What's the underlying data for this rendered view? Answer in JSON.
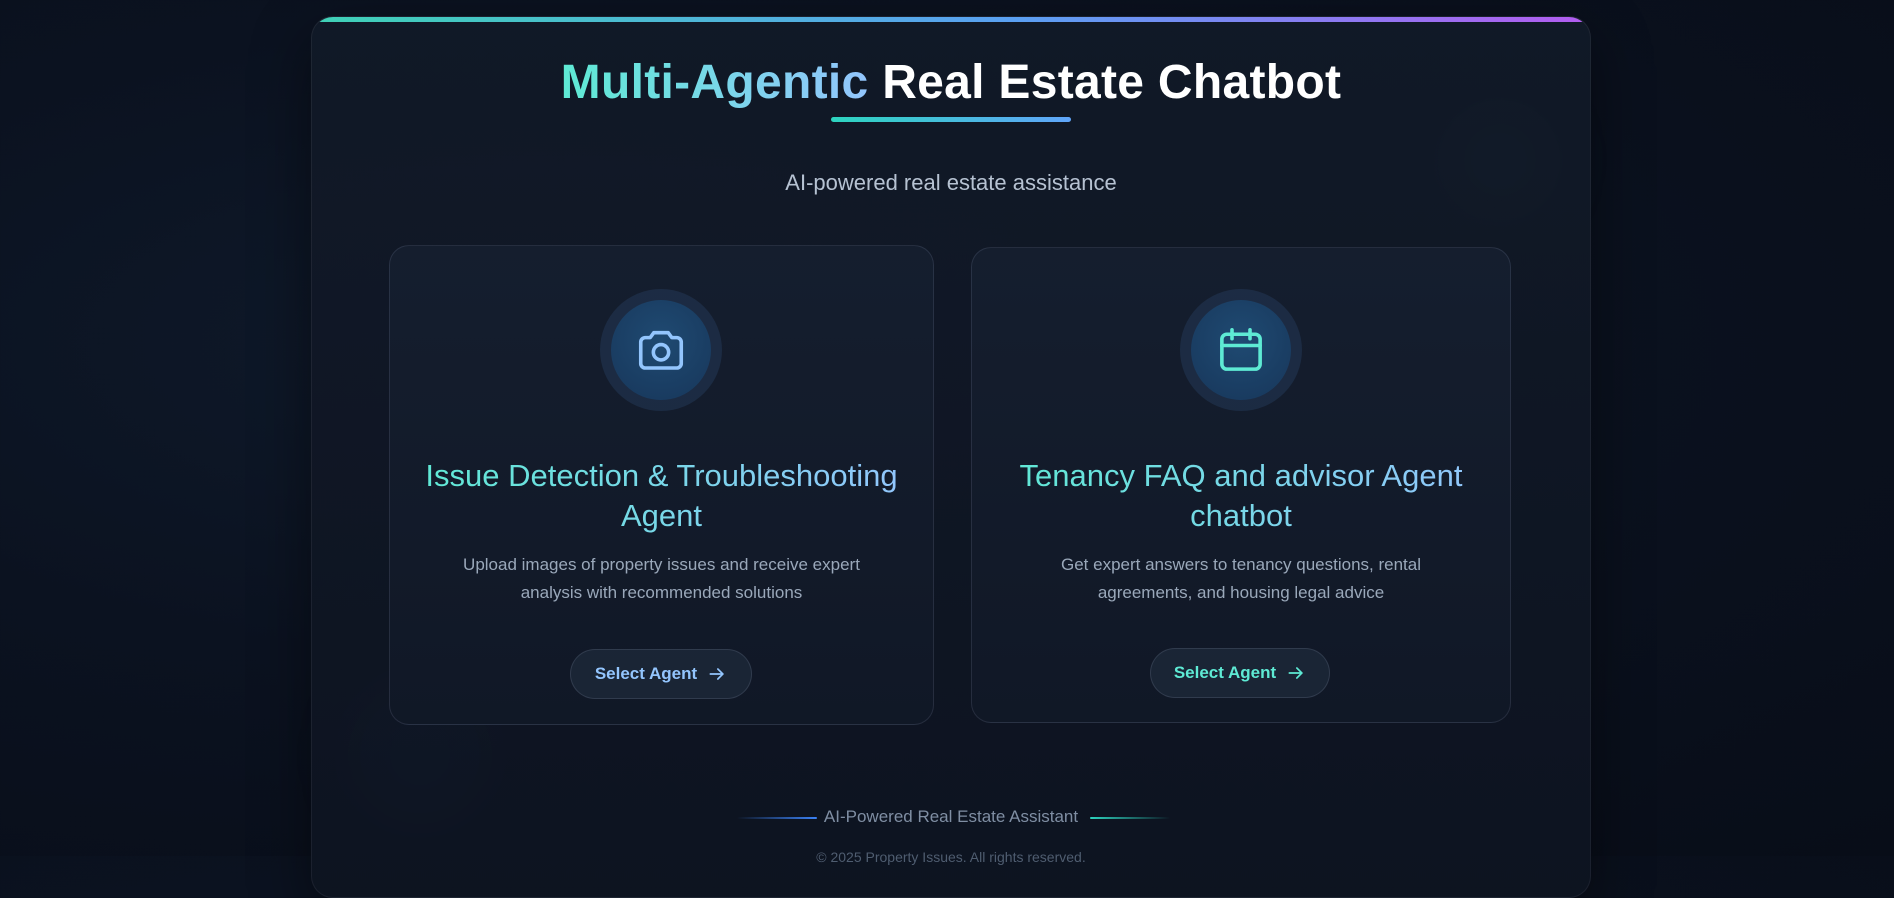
{
  "header": {
    "title_accent": "Multi-Agentic",
    "title_rest": "Real Estate Chatbot",
    "subtitle": "AI-powered real estate assistance"
  },
  "agents": [
    {
      "icon": "camera-icon",
      "title": "Issue Detection & Troubleshooting Agent",
      "description": "Upload images of property issues and receive expert analysis with recommended solutions",
      "button_label": "Select Agent"
    },
    {
      "icon": "calendar-icon",
      "title": "Tenancy FAQ and advisor Agent chatbot",
      "description": "Get expert answers to tenancy questions, rental agreements, and housing legal advice",
      "button_label": "Select Agent"
    }
  ],
  "footer": {
    "tagline": "AI-Powered Real Estate Assistant",
    "copyright": "© 2025 Property Issues. All rights reserved."
  },
  "colors": {
    "teal_accent": "#5eead4",
    "blue_accent": "#93c5fd",
    "purple_accent": "#b35cf0",
    "background": "#0b1220"
  }
}
